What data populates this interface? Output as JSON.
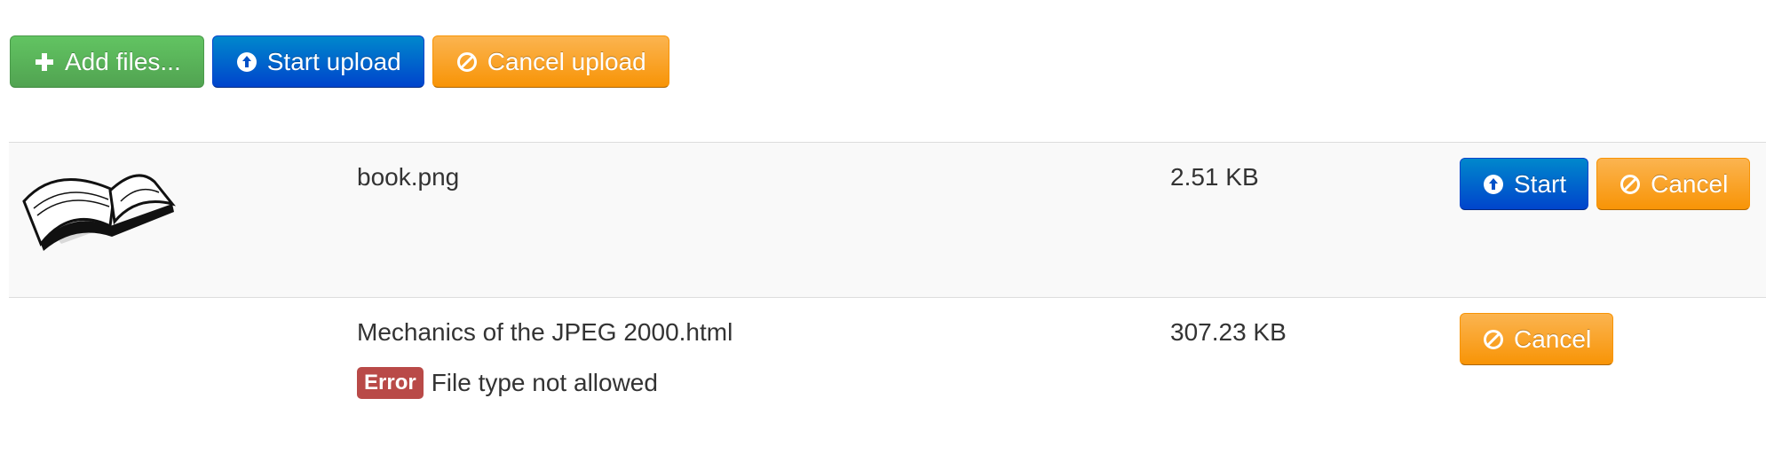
{
  "toolbar": {
    "add_files_label": "Add files...",
    "start_upload_label": "Start upload",
    "cancel_upload_label": "Cancel upload"
  },
  "files": [
    {
      "name": "book.png",
      "size": "2.51 KB",
      "start_label": "Start",
      "cancel_label": "Cancel",
      "preview_icon": "open-book"
    },
    {
      "name": "Mechanics of the JPEG 2000.html",
      "size": "307.23 KB",
      "error_badge": "Error",
      "error_message": "File type not allowed",
      "cancel_label": "Cancel"
    }
  ],
  "colors": {
    "success": "#5bb75b",
    "primary": "#0055cc",
    "warning": "#f9a12b",
    "danger": "#b94a48",
    "stripe": "#f9f9f9",
    "border": "#dddddd"
  }
}
